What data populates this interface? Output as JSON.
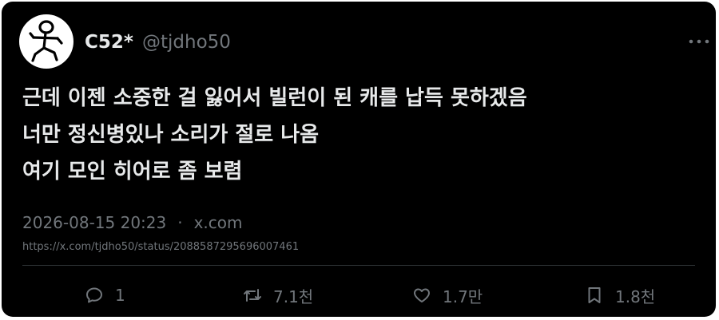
{
  "tweet": {
    "display_name": "C52*",
    "handle": "@tjdho50",
    "lines": [
      "근데 이젠 소중한 걸 잃어서 빌런이 된 캐를 납득 못하겠음",
      "너만 정신병있나 소리가 절로 나옴",
      "여기 모인 히어로 좀 보렴"
    ],
    "timestamp": "2026-08-15 20:23",
    "separator": "·",
    "source": "x.com",
    "url": "https://x.com/tjdho50/status/2088587295696007461"
  },
  "actions": {
    "reply_count": "1",
    "retweet_count": "7.1천",
    "like_count": "1.7만",
    "bookmark_count": "1.8천"
  },
  "icons": {
    "avatar": "stick-figure-avatar",
    "more": "more-horizontal-icon",
    "reply": "reply-icon",
    "retweet": "retweet-icon",
    "like": "heart-icon",
    "bookmark": "bookmark-icon"
  },
  "colors": {
    "background": "#000000",
    "text": "#e7e9ea",
    "secondary": "#71767b",
    "divider": "#2f3336"
  }
}
